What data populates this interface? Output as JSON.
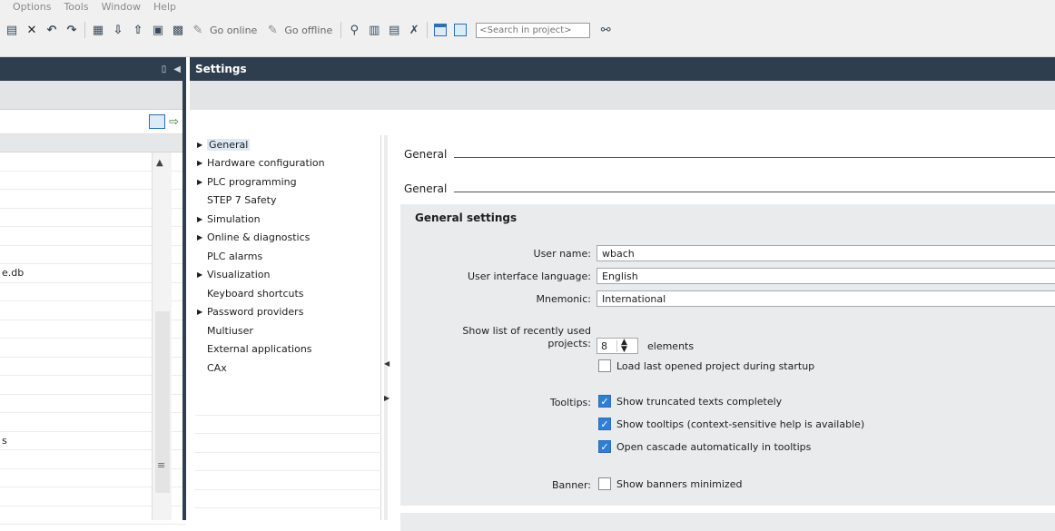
{
  "menu": [
    "Options",
    "Tools",
    "Window",
    "Help"
  ],
  "toolbar": {
    "go_online": "Go online",
    "go_offline": "Go offline",
    "search_placeholder": "<Search in project>"
  },
  "left_pane": {
    "tree_rows": [
      "",
      "",
      "",
      "",
      "",
      "",
      "e.db",
      "",
      "",
      "",
      "",
      "",
      "",
      "",
      "",
      "s",
      "",
      "",
      "",
      ""
    ]
  },
  "window": {
    "title": "Settings"
  },
  "nav": {
    "items": [
      {
        "label": "General",
        "expandable": true,
        "selected": true
      },
      {
        "label": "Hardware configuration",
        "expandable": true
      },
      {
        "label": "PLC programming",
        "expandable": true
      },
      {
        "label": "STEP 7 Safety",
        "expandable": false
      },
      {
        "label": "Simulation",
        "expandable": true
      },
      {
        "label": "Online & diagnostics",
        "expandable": true
      },
      {
        "label": "PLC alarms",
        "expandable": false
      },
      {
        "label": "Visualization",
        "expandable": true
      },
      {
        "label": "Keyboard shortcuts",
        "expandable": false
      },
      {
        "label": "Password providers",
        "expandable": true
      },
      {
        "label": "Multiuser",
        "expandable": false
      },
      {
        "label": "External applications",
        "expandable": false
      },
      {
        "label": "CAx",
        "expandable": false
      }
    ]
  },
  "content": {
    "heading1": "General",
    "heading2": "General",
    "panel_title": "General settings",
    "user_name_label": "User name:",
    "user_name_value": "wbach",
    "ui_language_label": "User interface language:",
    "ui_language_value": "English",
    "mnemonic_label": "Mnemonic:",
    "mnemonic_value": "International",
    "recent_label_line1": "Show list of recently used",
    "recent_label_line2": "projects:",
    "recent_value": "8",
    "recent_suffix": "elements",
    "load_last_label": "Load last opened project during startup",
    "load_last_checked": false,
    "tooltips_label": "Tooltips:",
    "tooltip_opt1": "Show truncated texts completely",
    "tooltip_opt1_checked": true,
    "tooltip_opt2": "Show tooltips (context-sensitive help is available)",
    "tooltip_opt2_checked": true,
    "tooltip_opt3": "Open cascade automatically in tooltips",
    "tooltip_opt3_checked": true,
    "banner_label": "Banner:",
    "banner_opt": "Show banners minimized",
    "banner_checked": false
  }
}
